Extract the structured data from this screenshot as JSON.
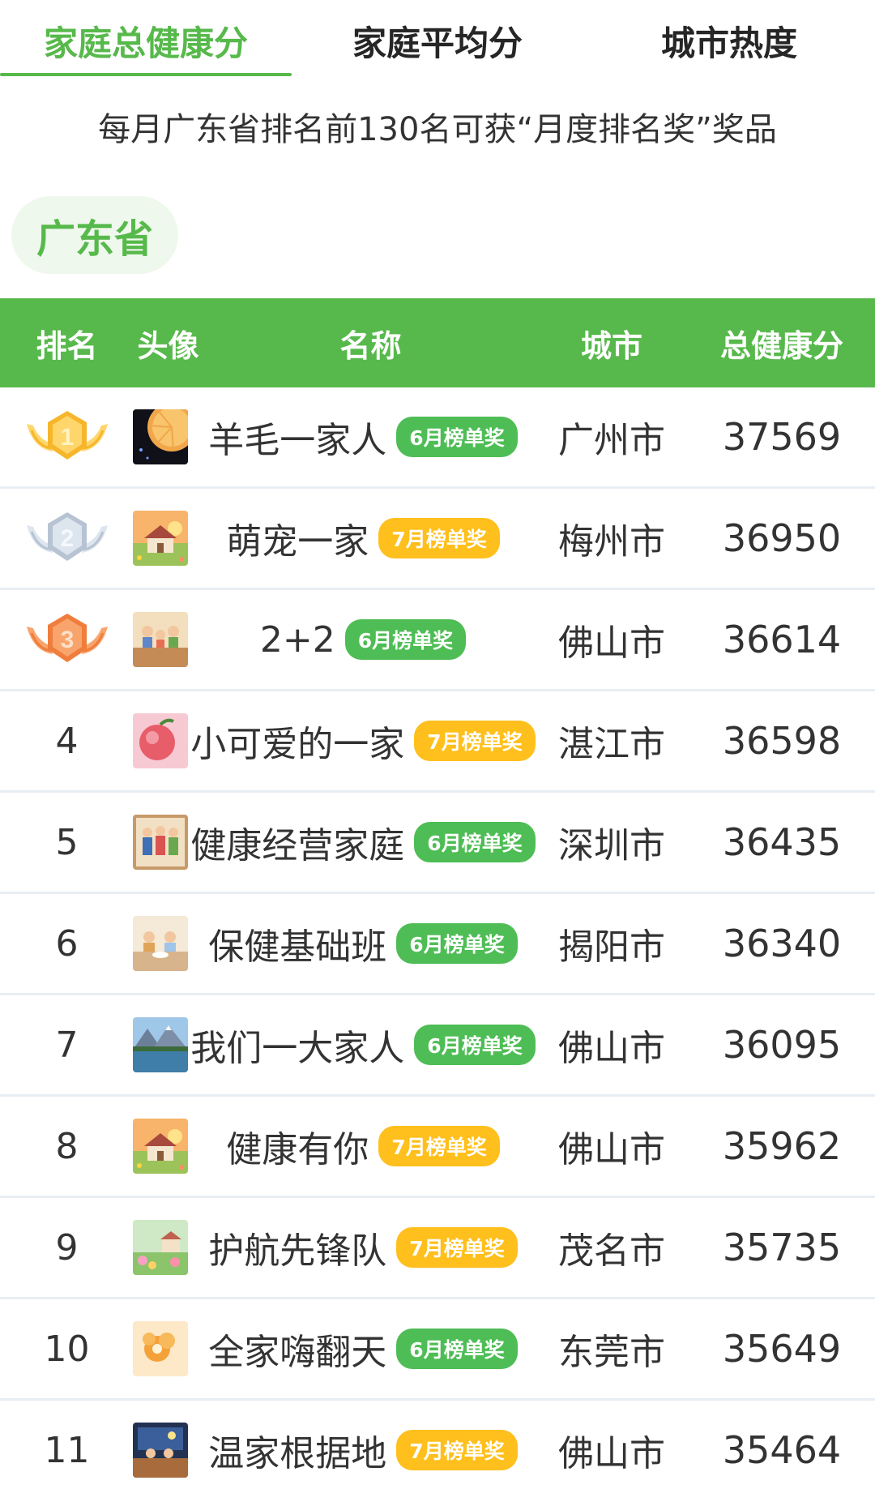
{
  "tabs": [
    {
      "label": "家庭总健康分",
      "active": true
    },
    {
      "label": "家庭平均分",
      "active": false
    },
    {
      "label": "城市热度",
      "active": false
    }
  ],
  "notice": "每月广东省排名前130名可获“月度排名奖”奖品",
  "region": "广东省",
  "columns": {
    "rank": "排名",
    "avatar": "头像",
    "name": "名称",
    "city": "城市",
    "score": "总健康分"
  },
  "colors": {
    "accent": "#57b94b",
    "badge_green": "#4ebd55",
    "badge_yellow": "#ffbf1c",
    "gold": "#f6b62c",
    "silver": "#c9d3df",
    "bronze": "#f08a4b"
  },
  "rows": [
    {
      "rank": "1",
      "medal": "gold-medal-icon",
      "name": "羊毛一家人",
      "badge": "6月榜单奖",
      "badge_color": "green",
      "city": "广州市",
      "score": "37569",
      "avatar": "orange-slice-avatar"
    },
    {
      "rank": "2",
      "medal": "silver-medal-icon",
      "name": "萌宠一家",
      "badge": "7月榜单奖",
      "badge_color": "yellow",
      "city": "梅州市",
      "score": "36950",
      "avatar": "sunset-house-avatar"
    },
    {
      "rank": "3",
      "medal": "bronze-medal-icon",
      "name": "2+2",
      "badge": "6月榜单奖",
      "badge_color": "green",
      "city": "佛山市",
      "score": "36614",
      "avatar": "family-dinner-avatar"
    },
    {
      "rank": "4",
      "name": "小可爱的一家",
      "badge": "7月榜单奖",
      "badge_color": "yellow",
      "city": "湛江市",
      "score": "36598",
      "avatar": "peach-avatar"
    },
    {
      "rank": "5",
      "name": "健康经营家庭",
      "badge": "6月榜单奖",
      "badge_color": "green",
      "city": "深圳市",
      "score": "36435",
      "avatar": "family-portrait-avatar"
    },
    {
      "rank": "6",
      "name": "保健基础班",
      "badge": "6月榜单奖",
      "badge_color": "green",
      "city": "揭阳市",
      "score": "36340",
      "avatar": "family-table-avatar"
    },
    {
      "rank": "7",
      "name": "我们一大家人",
      "badge": "6月榜单奖",
      "badge_color": "green",
      "city": "佛山市",
      "score": "36095",
      "avatar": "mountain-lake-avatar"
    },
    {
      "rank": "8",
      "name": "健康有你",
      "badge": "7月榜单奖",
      "badge_color": "yellow",
      "city": "佛山市",
      "score": "35962",
      "avatar": "sunset-house-avatar"
    },
    {
      "rank": "9",
      "name": "护航先锋队",
      "badge": "7月榜单奖",
      "badge_color": "yellow",
      "city": "茂名市",
      "score": "35735",
      "avatar": "garden-avatar"
    },
    {
      "rank": "10",
      "name": "全家嗨翻天",
      "badge": "6月榜单奖",
      "badge_color": "green",
      "city": "东莞市",
      "score": "35649",
      "avatar": "orange-flower-avatar"
    },
    {
      "rank": "11",
      "name": "温家根据地",
      "badge": "7月榜单奖",
      "badge_color": "yellow",
      "city": "佛山市",
      "score": "35464",
      "avatar": "night-room-avatar"
    }
  ]
}
